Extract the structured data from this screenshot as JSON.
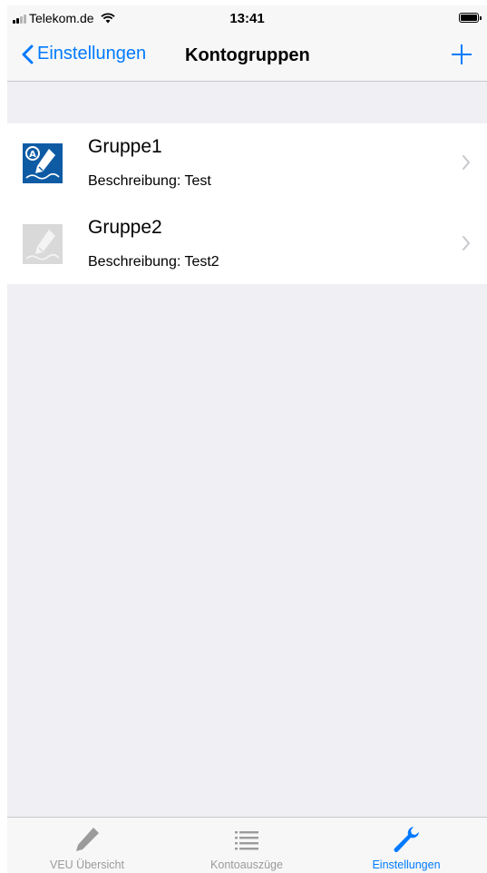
{
  "status_bar": {
    "carrier": "Telekom.de",
    "time": "13:41"
  },
  "nav": {
    "back_label": "Einstellungen",
    "title": "Kontogruppen",
    "add_icon": "plus-icon"
  },
  "groups": [
    {
      "title": "Gruppe1",
      "subtitle": "Beschreibung: Test",
      "icon": "signature-a-icon",
      "active": true
    },
    {
      "title": "Gruppe2",
      "subtitle": "Beschreibung: Test2",
      "icon": "signature-icon",
      "active": false
    }
  ],
  "tabs": [
    {
      "label": "VEU Übersicht",
      "icon": "pen-icon",
      "active": false
    },
    {
      "label": "Kontoauszüge",
      "icon": "list-icon",
      "active": false
    },
    {
      "label": "Einstellungen",
      "icon": "wrench-icon",
      "active": true
    }
  ],
  "colors": {
    "accent": "#007aff",
    "group_icon_active": "#0e5ba4",
    "group_icon_inactive": "#d9d9d9",
    "background": "#efeff4"
  }
}
